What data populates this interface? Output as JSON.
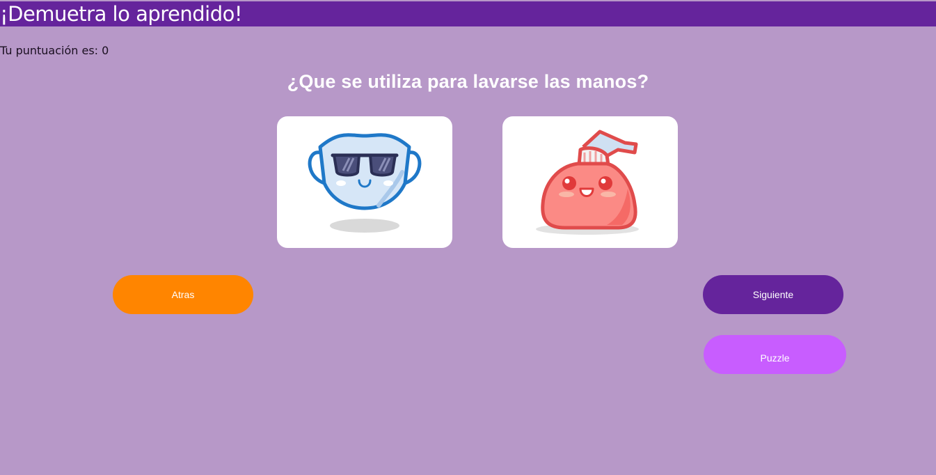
{
  "header": {
    "title": "¡Demuetra lo aprendido!",
    "background": "#65249c"
  },
  "score": {
    "text": "Tu puntuación es: 0"
  },
  "quiz": {
    "question": "¿Que se utiliza para lavarse las manos?",
    "options": [
      {
        "icon": "face-mask-with-sunglasses-icon"
      },
      {
        "icon": "soap-dispenser-icon"
      }
    ]
  },
  "buttons": {
    "back_label": "Atras",
    "next_label": "Siguiente",
    "puzzle_label": "Puzzle"
  },
  "colors": {
    "page_background": "#b798c8",
    "back_button": "#ff8500",
    "next_button": "#65249c",
    "puzzle_button": "#c85dff"
  }
}
